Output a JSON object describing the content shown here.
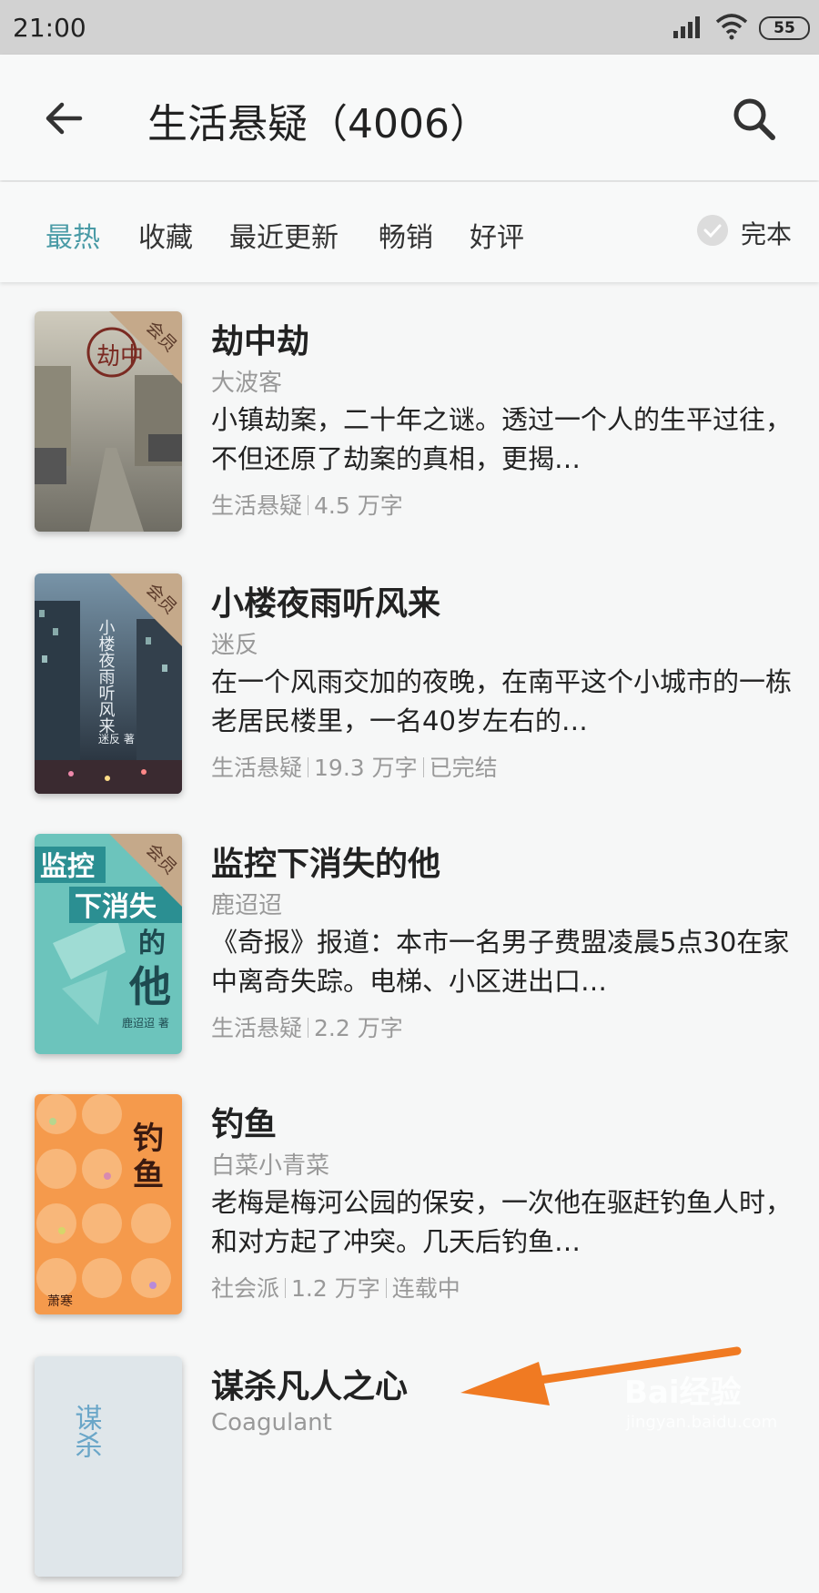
{
  "status": {
    "time": "21:00",
    "battery": "55"
  },
  "header": {
    "title": "生活悬疑（4006）"
  },
  "filters": {
    "tabs": [
      "最热",
      "收藏",
      "最近更新",
      "畅销",
      "好评"
    ],
    "active_index": 0,
    "complete_label": "完本"
  },
  "books": [
    {
      "title": "劫中劫",
      "author": "大波客",
      "desc": "小镇劫案，二十年之谜。透过一个人的生平过往，不但还原了劫案的真相，更揭…",
      "meta": [
        "生活悬疑",
        "4.5 万字"
      ],
      "badge": "会员"
    },
    {
      "title": "小楼夜雨听风来",
      "author": "迷反",
      "desc": "在一个风雨交加的夜晚，在南平这个小城市的一栋老居民楼里，一名40岁左右的…",
      "meta": [
        "生活悬疑",
        "19.3 万字",
        "已完结"
      ],
      "badge": "会员"
    },
    {
      "title": "监控下消失的他",
      "author": "鹿迢迢",
      "desc": "《奇报》报道：本市一名男子费盟凌晨5点30在家中离奇失踪。电梯、小区进出口…",
      "meta": [
        "生活悬疑",
        "2.2 万字"
      ],
      "badge": "会员"
    },
    {
      "title": "钓鱼",
      "author": "白菜小青菜",
      "desc": "老梅是梅河公园的保安，一次他在驱赶钓鱼人时，和对方起了冲突。几天后钓鱼…",
      "meta": [
        "社会派",
        "1.2 万字",
        "连载中"
      ],
      "badge": ""
    },
    {
      "title": "谋杀凡人之心",
      "author": "Coagulant",
      "desc": "",
      "meta": [],
      "badge": ""
    }
  ],
  "cover_text": {
    "b1_stamp": "劫中",
    "b2_title": "小楼夜雨听风来",
    "b2_author": "迷反 著",
    "b3_title1": "监控",
    "b3_title2": "下消失",
    "b3_title3": "的",
    "b3_title4": "他",
    "b3_author": "鹿迢迢 著",
    "b4_title1": "钓",
    "b4_title2": "鱼",
    "b4_author": "萧寒",
    "b5_title": "谋杀"
  },
  "watermark": {
    "brand": "Bai经验",
    "url": "jingyan.baidu.com"
  },
  "colors": {
    "accent": "#4a9ba6",
    "arrow": "#f07a22"
  }
}
